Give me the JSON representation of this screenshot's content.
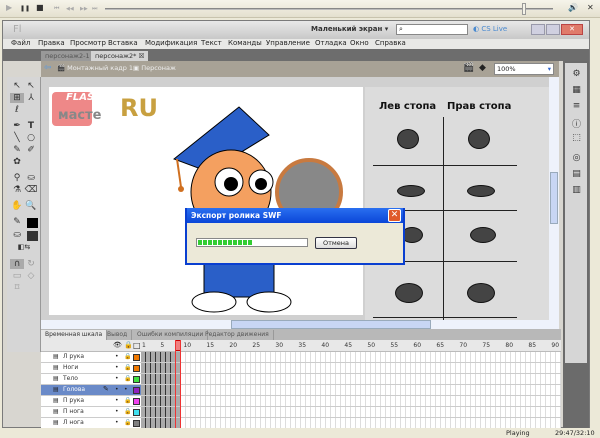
{
  "media_bar": {
    "play": "▶",
    "pause": "❚❚",
    "stop": "■",
    "prev": "⏮",
    "rew": "◀◀",
    "ffw": "▶▶",
    "next": "⏭",
    "volume_icon": "speaker-icon",
    "close": "✕",
    "seek_fraction": 0.93
  },
  "app": {
    "logo": "Fl",
    "workspace": "Маленький экран",
    "search_placeholder": "",
    "cs_live": "CS Live"
  },
  "menu": [
    "Файл",
    "Правка",
    "Просмотр",
    "Вставка",
    "Модификация",
    "Текст",
    "Команды",
    "Управление",
    "Отладка",
    "Окно",
    "Справка"
  ],
  "doc_tabs": [
    {
      "label": "персонаж2-1",
      "active": false
    },
    {
      "label": "персонаж2*",
      "active": true
    }
  ],
  "breadcrumb": {
    "scene": "Монтажный кадр 1",
    "symbol": "Персонаж",
    "zoom": "100%"
  },
  "stage": {
    "logo_flash": "FLASH",
    "logo_master": "масте",
    "logo_ru": "RU",
    "col_left": "Лев стопа",
    "col_right": "Прав стопа"
  },
  "timeline": {
    "tabs": [
      "Временная шкала",
      "Вывод",
      "Ошибки компиляции",
      "Редактор движения"
    ],
    "frame_numbers": [
      "1",
      "5",
      "10",
      "15",
      "20",
      "25",
      "30",
      "35",
      "40",
      "45",
      "50",
      "55",
      "60",
      "65",
      "70",
      "75",
      "80",
      "85",
      "90"
    ],
    "current_frame": 8,
    "layers": [
      {
        "name": "Л рука",
        "color": "#f07800",
        "selected": false
      },
      {
        "name": "Ноги",
        "color": "#f07800",
        "selected": false
      },
      {
        "name": "Тело",
        "color": "#40e040",
        "selected": false
      },
      {
        "name": "Голова",
        "color": "#9020c0",
        "selected": true
      },
      {
        "name": "П рука",
        "color": "#f040f0",
        "selected": false
      },
      {
        "name": "П нога",
        "color": "#40e0f0",
        "selected": false
      },
      {
        "name": "Л нога",
        "color": "#808080",
        "selected": false
      }
    ]
  },
  "dialog": {
    "title": "Экспорт ролика SWF",
    "cancel": "Отмена",
    "progress": 0.5
  },
  "status": {
    "state": "Playing",
    "time": "29:47/32:10"
  }
}
